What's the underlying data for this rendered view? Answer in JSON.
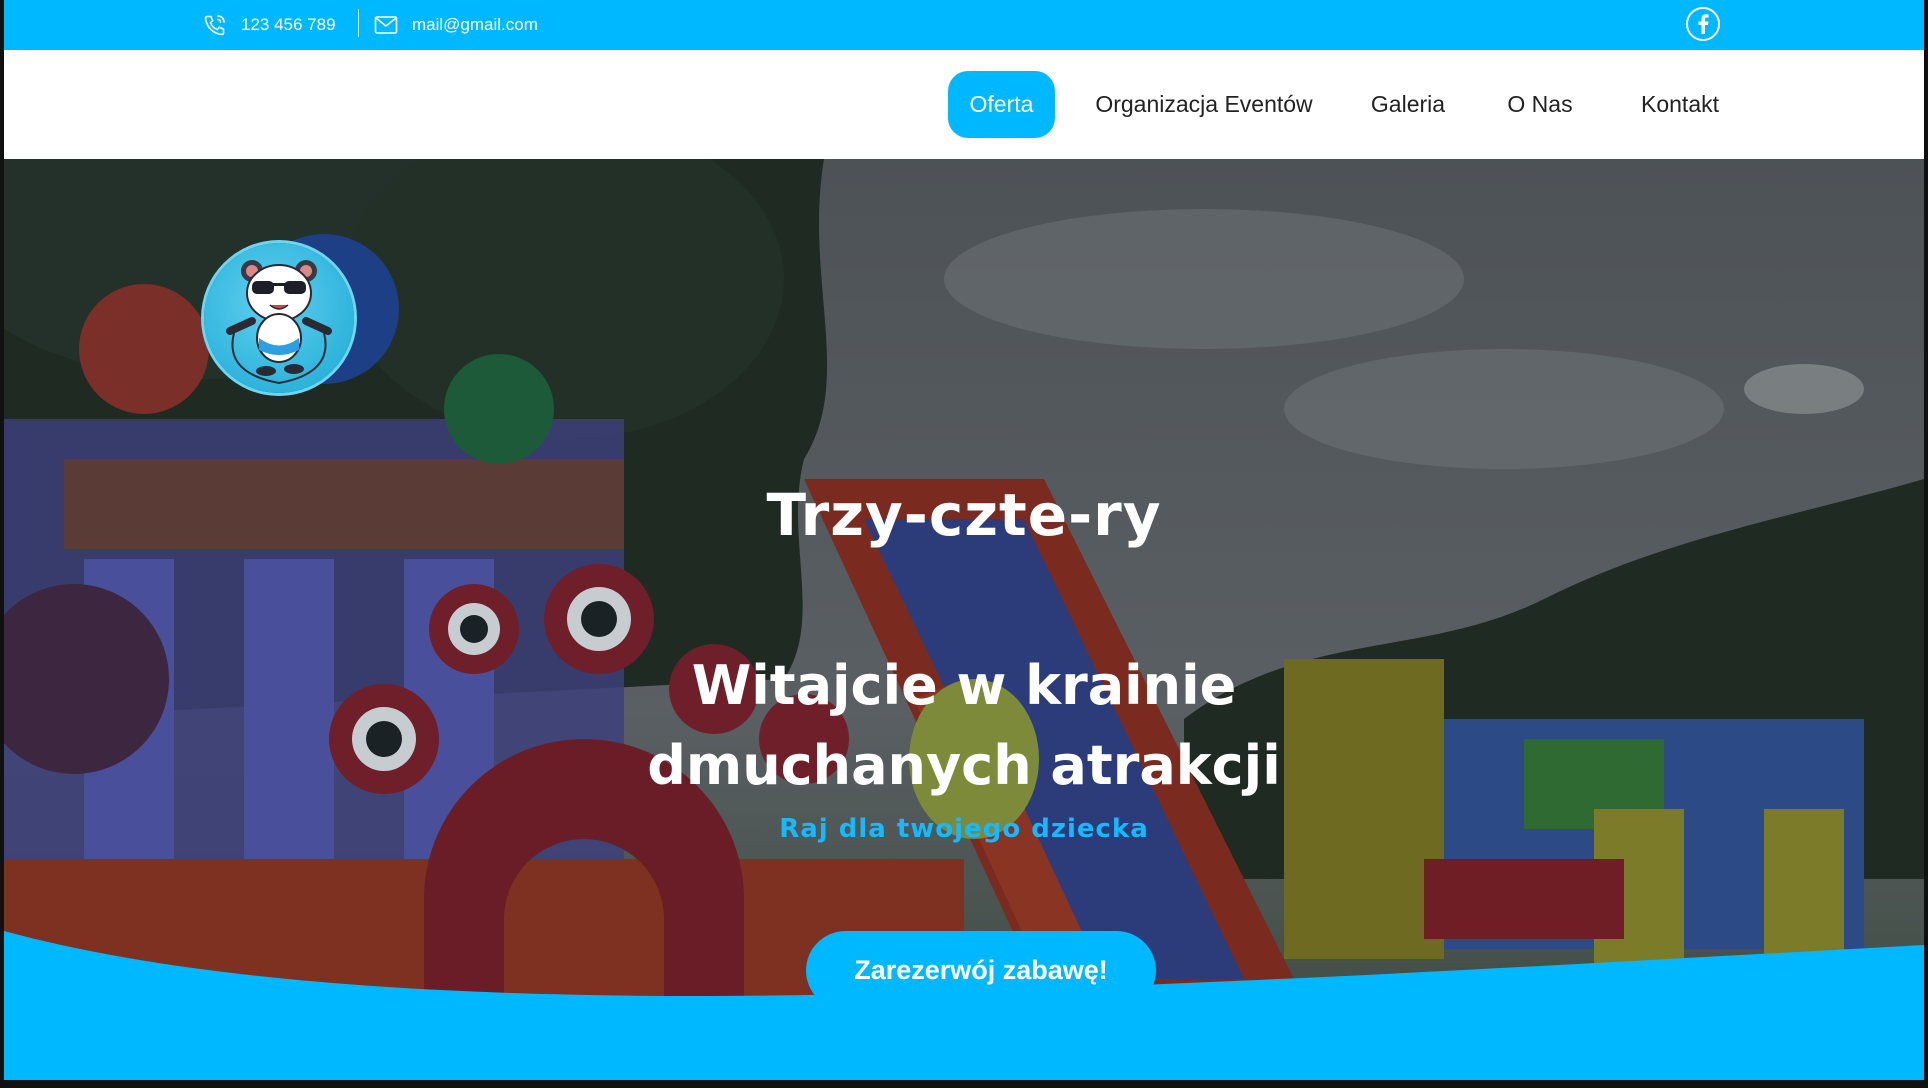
{
  "topbar": {
    "phone": "123 456 789",
    "email": "mail@gmail.com",
    "icons": {
      "phone": "phone-icon",
      "mail": "mail-icon",
      "social": "facebook-icon"
    }
  },
  "nav": {
    "items": [
      {
        "label": "Oferta",
        "active": true
      },
      {
        "label": "Organizacja Eventów",
        "active": false
      },
      {
        "label": "Galeria",
        "active": false
      },
      {
        "label": "O Nas",
        "active": false
      },
      {
        "label": "Kontakt",
        "active": false
      }
    ]
  },
  "hero": {
    "title": "Trzy-czte-ry",
    "heading_line1": "Witajcie w krainie",
    "heading_line2": "dmuchanych atrakcji",
    "tagline": "Raj dla twojego dziecka",
    "cta_label": "Zarezerwój zabawę!"
  },
  "colors": {
    "accent": "#00b8ff",
    "nav_text": "#222222",
    "hero_text": "#ffffff"
  }
}
